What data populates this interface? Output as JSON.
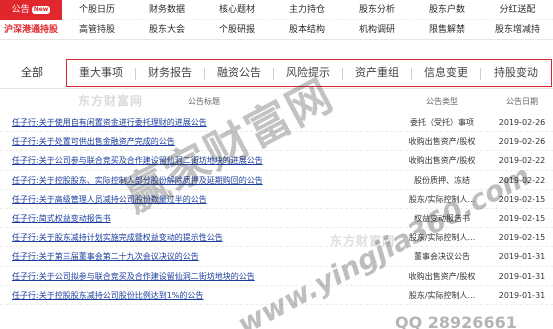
{
  "nav": {
    "row1": [
      "公告",
      "个股日历",
      "财务数据",
      "核心题材",
      "主力持仓",
      "股东分析",
      "股东户数",
      "分红送配"
    ],
    "new_badge": "New",
    "row2": [
      "沪深港通持股",
      "高管持股",
      "股东大会",
      "个股研报",
      "股本结构",
      "机构调研",
      "限售解禁",
      "股东增减持"
    ]
  },
  "tabs": {
    "all": "全部",
    "items": [
      "重大事项",
      "财务报告",
      "融资公告",
      "风险提示",
      "资产重组",
      "信息变更",
      "持股变动"
    ]
  },
  "table": {
    "headers": {
      "title": "公告标题",
      "type": "公告类型",
      "date": "公告日期"
    },
    "rows": [
      {
        "title": "任子行:关于使用自有闲置资金进行委托理财的进展公告",
        "type": "委托（受托）事项",
        "date": "2019-02-26"
      },
      {
        "title": "任子行:关于处置可供出售金融资产完成的公告",
        "type": "收购出售资产/股权",
        "date": "2019-02-26"
      },
      {
        "title": "任子行:关于公司参与联合竞买及合作建设留仙洞二街坊地块的进展公告",
        "type": "收购出售资产/股权",
        "date": "2019-02-22"
      },
      {
        "title": "任子行:关于控股股东、实际控制人部分股份解除质押及延期购回的公告",
        "type": "股份质押、冻结",
        "date": "2019-02-22"
      },
      {
        "title": "任子行:关于高级管理人员减持公司股份数量过半的公告",
        "type": "股东/实际控制人...",
        "date": "2019-02-15"
      },
      {
        "title": "任子行:简式权益变动报告书",
        "type": "权益变动报告书",
        "date": "2019-02-15"
      },
      {
        "title": "任子行:关于股东减持计划实施完成暨权益变动的提示性公告",
        "type": "股东/实际控制人...",
        "date": "2019-02-15"
      },
      {
        "title": "任子行:关于第三届董事会第二十九次会议决议的公告",
        "type": "董事会决议公告",
        "date": "2019-01-31"
      },
      {
        "title": "任子行:关于公司拟参与联合竞买及合作建设留仙洞二街坊地块的公告",
        "type": "收购出售资产/股权",
        "date": "2019-01-31"
      },
      {
        "title": "任子行:关于控股股东减持公司股份比例达到1%的公告",
        "type": "股东/实际控制人...",
        "date": "2019-01-31"
      }
    ]
  },
  "watermarks": {
    "logo_top": "东方财富网",
    "logo_mid": "东方财富网",
    "big_text": "赢家财富网",
    "url": "www.yingjia360.com",
    "qq": "QQ 28926661"
  },
  "colors": {
    "accent": "#e0272d",
    "link": "#1a3c9c"
  }
}
